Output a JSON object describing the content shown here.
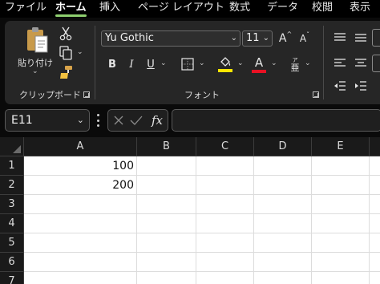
{
  "menu": {
    "tabs": [
      {
        "label": "ファイル"
      },
      {
        "label": "ホーム"
      },
      {
        "label": "挿入"
      },
      {
        "label": "ページ レイアウト"
      },
      {
        "label": "数式"
      },
      {
        "label": "データ"
      },
      {
        "label": "校閲"
      },
      {
        "label": "表示"
      }
    ],
    "active_index": 1
  },
  "ribbon": {
    "clipboard": {
      "paste_label": "貼り付け",
      "group_label": "クリップボード"
    },
    "font": {
      "font_name": "Yu Gothic",
      "font_size": "11",
      "bold": "B",
      "italic": "I",
      "underline": "U",
      "grow": "A",
      "shrink": "A",
      "font_color_letter": "A",
      "phonetic": "ア",
      "phonetic_small": "亜",
      "group_label": "フォント"
    },
    "colors": {
      "highlight": "#ffe600",
      "font_color": "#e81123",
      "accent": "#8ecf6f"
    }
  },
  "formula_bar": {
    "name_box": "E11",
    "fx": "fx",
    "value": ""
  },
  "sheet": {
    "columns": [
      "A",
      "B",
      "C",
      "D",
      "E"
    ],
    "rows": [
      "1",
      "2",
      "3",
      "4",
      "5",
      "6",
      "7"
    ],
    "cells": {
      "A1": "100",
      "A2": "200"
    }
  }
}
